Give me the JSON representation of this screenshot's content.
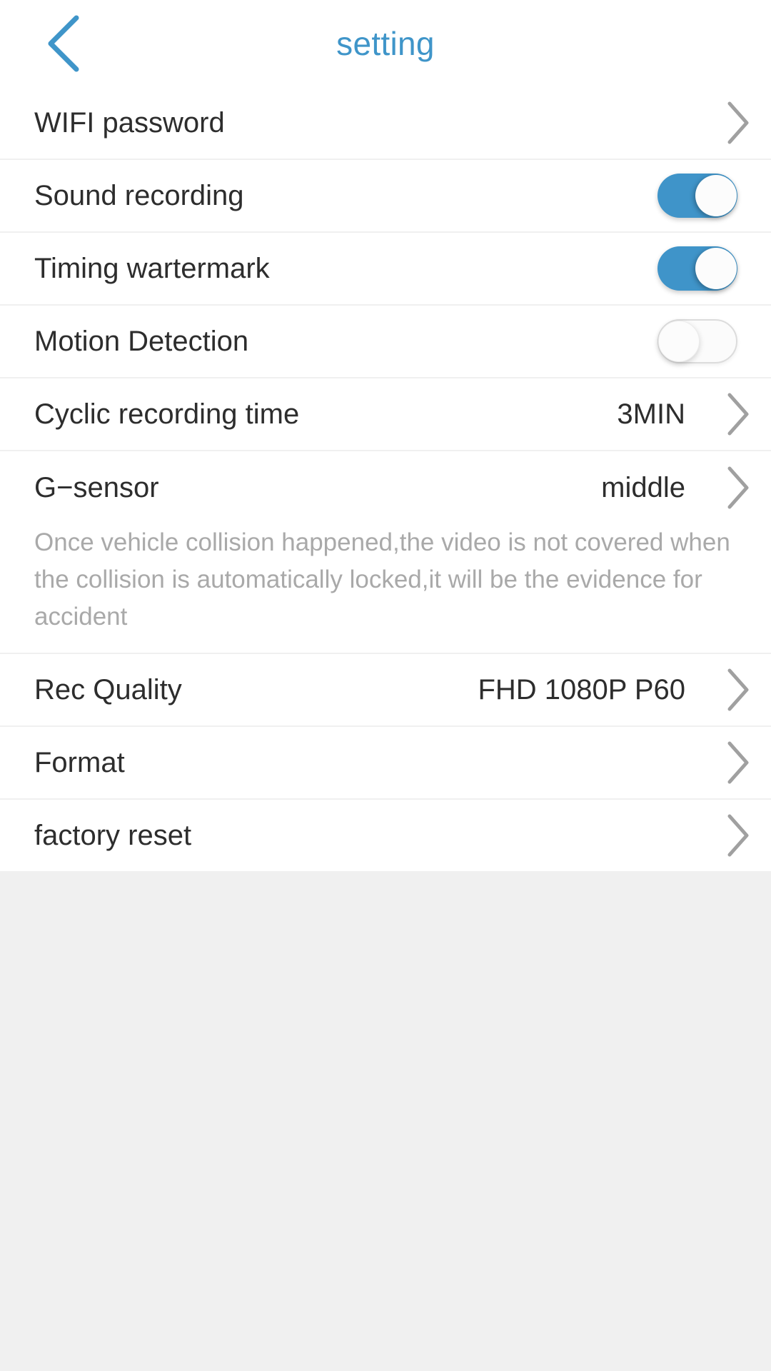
{
  "header": {
    "title": "setting",
    "back_icon": "chevron-left-icon",
    "accent_color": "#3f95c9"
  },
  "colors": {
    "accent": "#3f95c9",
    "toggle_on": "#3f94c9",
    "toggle_off_track": "#fbfbfb",
    "chevron": "#a0a0a0",
    "row_text": "#2d2d2d",
    "desc_text": "#a9a9a9",
    "page_bg": "#f0f0f0",
    "row_bg": "#ffffff"
  },
  "rows": [
    {
      "label": "WIFI password",
      "type": "link",
      "value": "",
      "accessory": "chevron-right-icon"
    },
    {
      "label": "Sound recording",
      "type": "toggle",
      "value": "",
      "toggle_state": "on",
      "accessory": "toggle-switch"
    },
    {
      "label": "Timing wartermark",
      "type": "toggle",
      "value": "",
      "toggle_state": "on",
      "accessory": "toggle-switch"
    },
    {
      "label": "Motion Detection",
      "type": "toggle",
      "value": "",
      "toggle_state": "off",
      "accessory": "toggle-switch"
    },
    {
      "label": "Cyclic recording time",
      "type": "link",
      "value": "3MIN",
      "accessory": "chevron-right-icon"
    },
    {
      "label": "G−sensor",
      "type": "link",
      "value": "middle",
      "accessory": "chevron-right-icon"
    }
  ],
  "description": "Once vehicle collision happened,the video is not covered when the collision is automatically locked,it will be the evidence for accident",
  "rows_after": [
    {
      "label": "Rec Quality",
      "type": "link",
      "value": "FHD 1080P P60",
      "accessory": "chevron-right-icon"
    },
    {
      "label": "Format",
      "type": "link",
      "value": "",
      "accessory": "chevron-right-icon"
    },
    {
      "label": "factory reset",
      "type": "link",
      "value": "",
      "accessory": "chevron-right-icon"
    }
  ]
}
